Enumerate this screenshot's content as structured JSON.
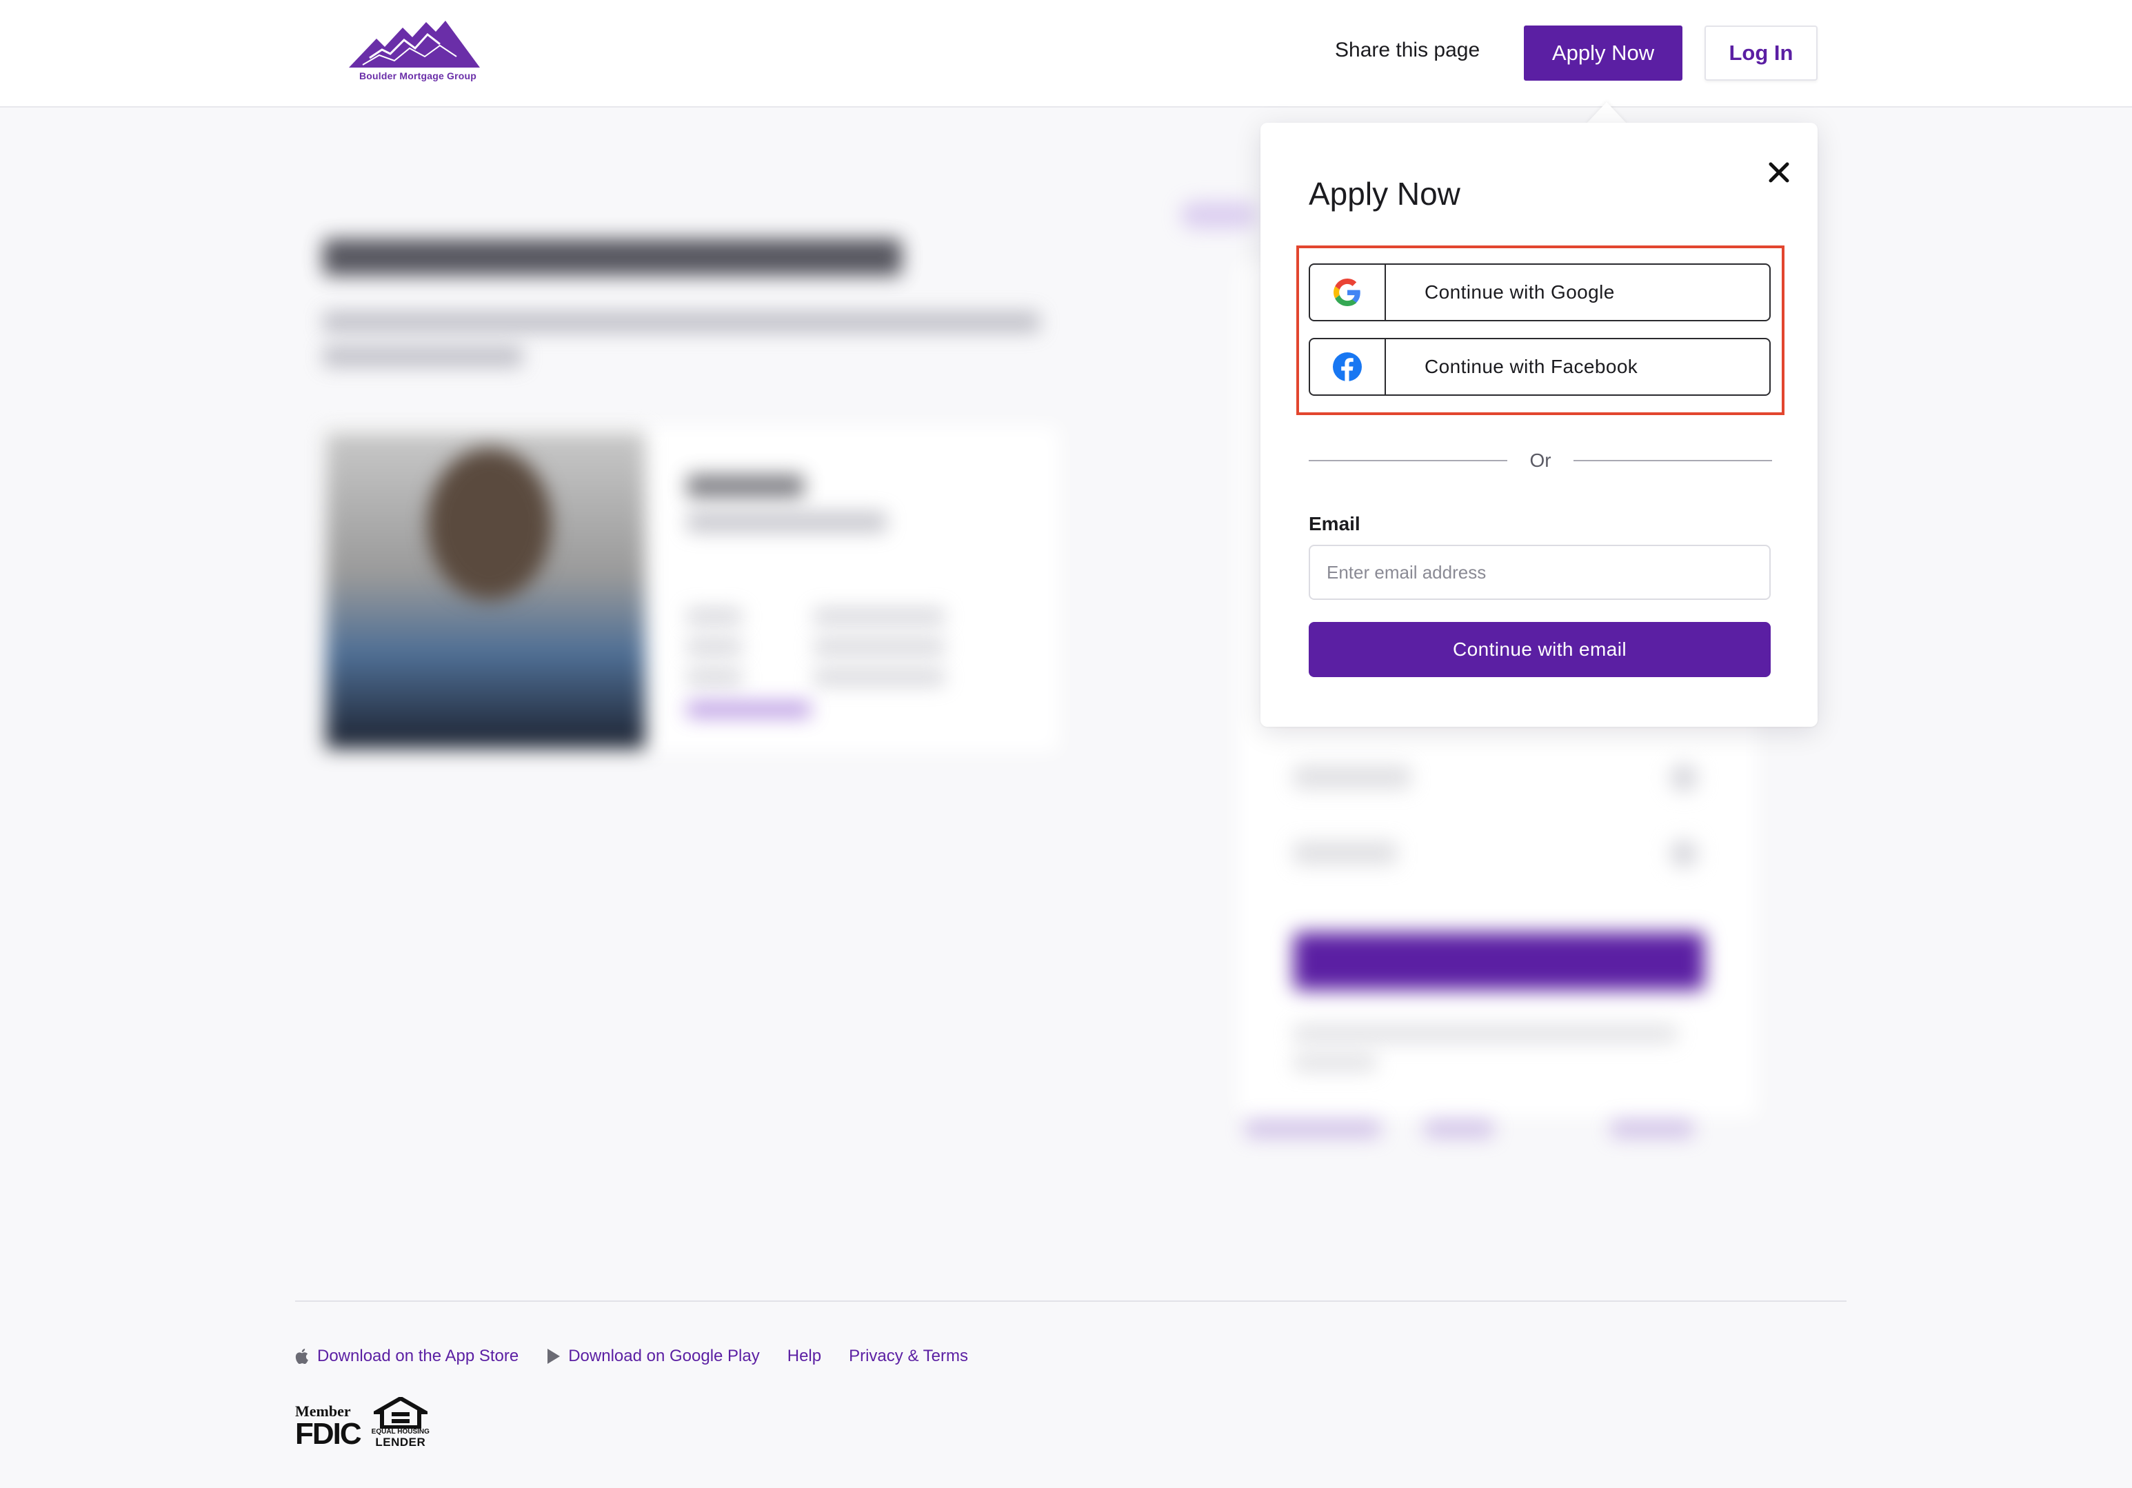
{
  "header": {
    "logo_text": "Boulder Mortgage Group",
    "share_label": "Share this page",
    "apply_label": "Apply Now",
    "login_label": "Log In"
  },
  "apply_popover": {
    "title": "Apply Now",
    "google_label": "Continue with Google",
    "facebook_label": "Continue with Facebook",
    "divider_text": "Or",
    "email_label": "Email",
    "email_placeholder": "Enter email address",
    "email_value": "",
    "continue_email_label": "Continue with email"
  },
  "footer": {
    "links": [
      {
        "label": "Download on the App Store",
        "icon": "apple-icon"
      },
      {
        "label": "Download on Google Play",
        "icon": "play-icon"
      },
      {
        "label": "Help",
        "icon": ""
      },
      {
        "label": "Privacy & Terms",
        "icon": ""
      }
    ],
    "fdic_member": "Member",
    "fdic_word": "FDIC",
    "ehl_text": "EQUAL HOUSING",
    "ehl_lender": "LENDER"
  },
  "colors": {
    "brand_purple": "#5b1fa3",
    "highlight_red": "#e2462f",
    "page_bg": "#f8f8fa"
  }
}
